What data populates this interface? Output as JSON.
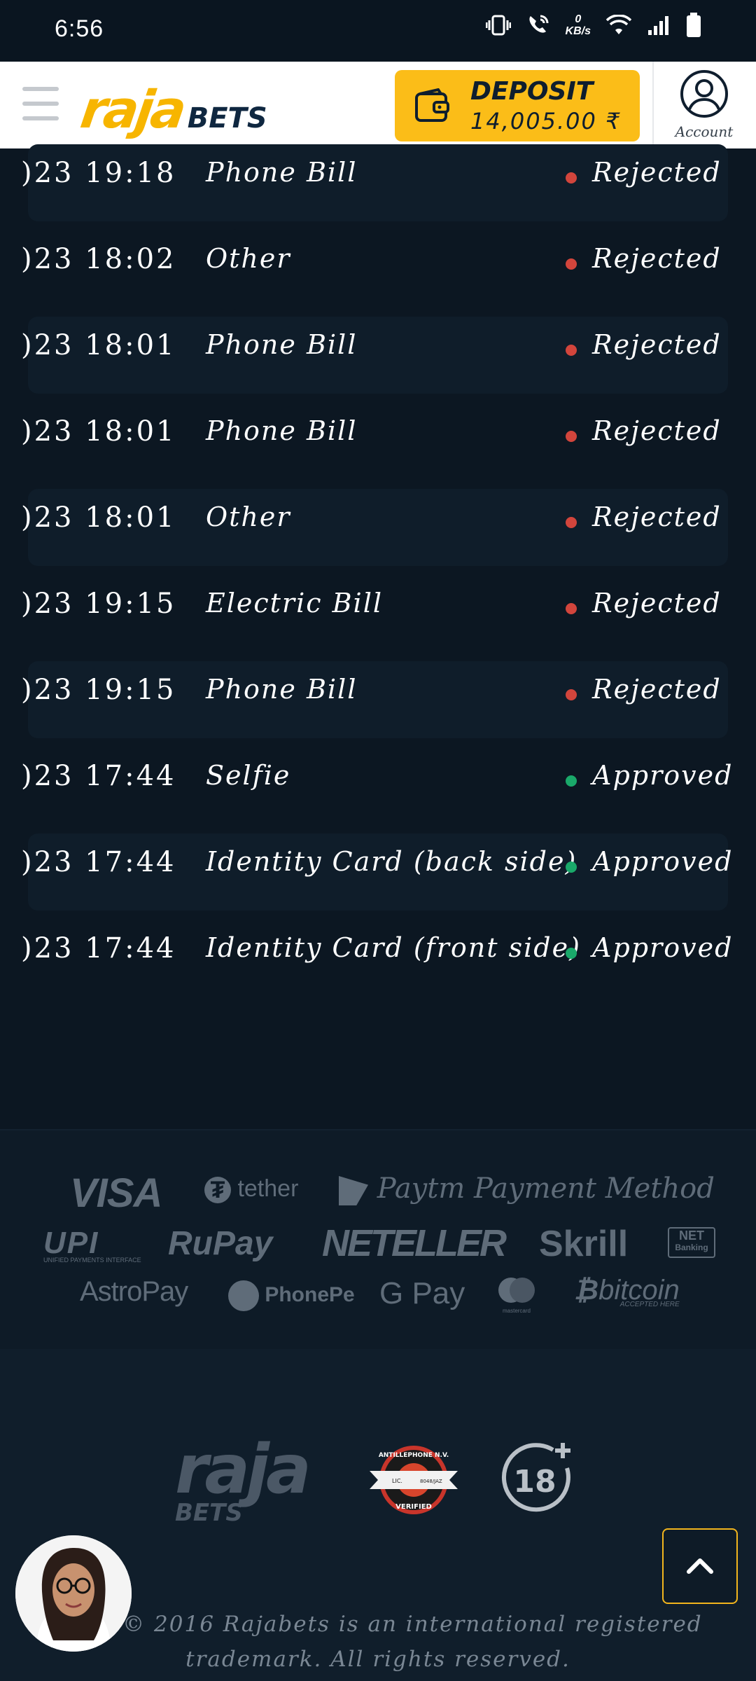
{
  "status_bar": {
    "time": "6:56",
    "net_speed_value": "0",
    "net_speed_unit": "KB/s"
  },
  "header": {
    "logo_primary": "raja",
    "logo_secondary": "BETS",
    "deposit_label": "DEPOSIT",
    "deposit_amount": "14,005.00 ₹",
    "account_label": "Account"
  },
  "status_colors": {
    "Rejected": "#d2453c",
    "Approved": "#1aa96a"
  },
  "documents": [
    {
      "date": ")23 19:18",
      "type": "Phone Bill",
      "status": "Rejected",
      "shaded": true
    },
    {
      "date": ")23 18:02",
      "type": "Other",
      "status": "Rejected",
      "shaded": false
    },
    {
      "date": ")23 18:01",
      "type": "Phone Bill",
      "status": "Rejected",
      "shaded": true
    },
    {
      "date": ")23 18:01",
      "type": "Phone Bill",
      "status": "Rejected",
      "shaded": false
    },
    {
      "date": ")23 18:01",
      "type": "Other",
      "status": "Rejected",
      "shaded": true
    },
    {
      "date": ")23 19:15",
      "type": "Electric Bill",
      "status": "Rejected",
      "shaded": false
    },
    {
      "date": ")23 19:15",
      "type": "Phone Bill",
      "status": "Rejected",
      "shaded": true
    },
    {
      "date": ")23 17:44",
      "type": "Selfie",
      "status": "Approved",
      "shaded": false
    },
    {
      "date": ")23 17:44",
      "type": "Identity Card (back side)",
      "status": "Approved",
      "shaded": true
    },
    {
      "date": ")23 17:44",
      "type": "Identity Card (front side)",
      "status": "Approved",
      "shaded": false
    }
  ],
  "payment_methods": {
    "visa": "VISA",
    "tether": "tether",
    "paytm": "Paytm Payment Method",
    "upi": "UPI",
    "upi_sub": "UNIFIED PAYMENTS INTERFACE",
    "rupay": "RuPay",
    "neteller": "NETELLER",
    "skrill": "Skrill",
    "netbanking_1": "NET",
    "netbanking_2": "Banking",
    "astropay": "AstroPay",
    "phonepe": "PhonePe",
    "gpay": "G Pay",
    "mastercard": "mastercard",
    "bitcoin": "bitcoin",
    "bitcoin_sub": "ACCEPTED HERE"
  },
  "footer": {
    "logo_primary": "raja",
    "logo_secondary": "BETS",
    "badge_top": "ANTILLEPHONE N.V.",
    "badge_bottom": "VERIFIED",
    "badge_lic": "LIC.",
    "badge_num": "8048/JAZ",
    "age_label": "18",
    "copyright_line1": "right © 2016 Rajabets is an international registered",
    "copyright_line2": "trademark. All rights reserved."
  }
}
